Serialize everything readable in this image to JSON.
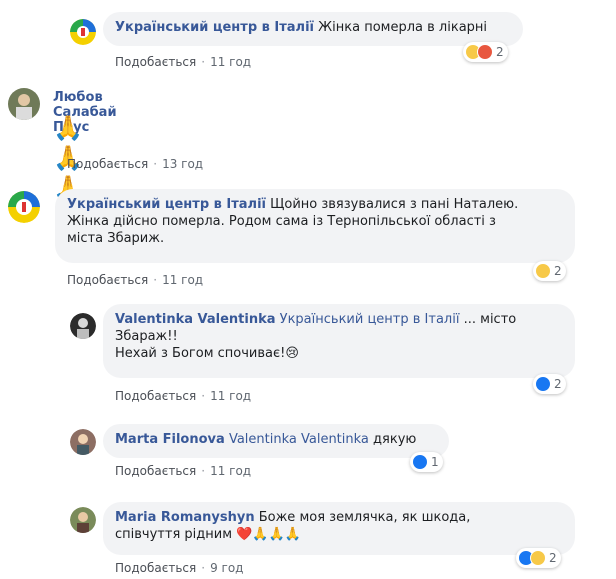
{
  "comments": [
    {
      "author": "Український центр в Італії",
      "text": "Жінка померла в лікарні",
      "like_label": "Подобається",
      "time": "11 год",
      "reactions": [
        "sad",
        "angry"
      ],
      "reaction_count": "2"
    },
    {
      "author": "Любов Салабай Прус",
      "text": "🙏🙏🙏",
      "like_label": "Подобається",
      "time": "13 год"
    },
    {
      "author": "Український центр в Італії",
      "text_line1": "Щойно звязувалися з пані Наталею.",
      "text_line2": "Жінка дійсно померла. Родом сама із Тернопільської області з",
      "text_line3": "міста Збариж.",
      "like_label": "Подобається",
      "time": "11 год",
      "reactions": [
        "sad"
      ],
      "reaction_count": "2"
    },
    {
      "author": "Valentinka Valentinka",
      "mention": "Український центр в Італії",
      "text_line1": " ... місто",
      "text_line2": "Збараж!!",
      "text_line3": "Нехай з Богом спочиває!😢",
      "like_label": "Подобається",
      "time": "11 год",
      "reactions": [
        "like"
      ],
      "reaction_count": "2"
    },
    {
      "author": "Marta Filonova",
      "mention": "Valentinka Valentinka",
      "text": " дякую",
      "like_label": "Подобається",
      "time": "11 год",
      "reactions": [
        "like"
      ],
      "reaction_count": "1"
    },
    {
      "author": "Maria Romanyshyn",
      "text_line1": " Боже моя землячка, як шкода,",
      "text_line2": "співчуття рідним ❤️🙏🙏🙏",
      "like_label": "Подобається",
      "time": "9 год",
      "reactions": [
        "like",
        "sad"
      ],
      "reaction_count": "2"
    }
  ],
  "separator": "·",
  "colors": {
    "author": "#385898",
    "bubble": "#f2f3f5",
    "like": "#1877f2",
    "sad": "#f7c948",
    "angry": "#e8573f"
  }
}
